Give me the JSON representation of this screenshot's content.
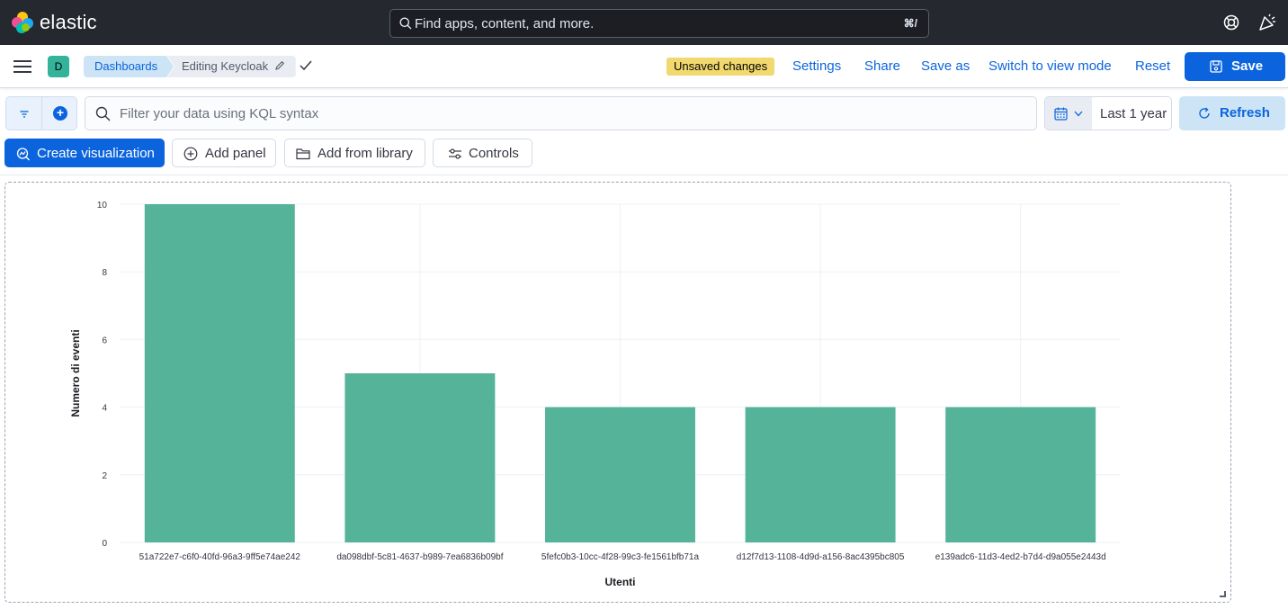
{
  "header": {
    "logo_text": "elastic",
    "search_placeholder": "Find apps, content, and more.",
    "search_shortcut": "⌘/"
  },
  "breadcrumbs": {
    "space_initial": "D",
    "items": [
      "Dashboards",
      "Editing Keycloak"
    ]
  },
  "top_actions": {
    "unsaved_badge": "Unsaved changes",
    "settings": "Settings",
    "share": "Share",
    "save_as": "Save as",
    "switch_mode": "Switch to view mode",
    "reset": "Reset",
    "save": "Save"
  },
  "query_bar": {
    "placeholder": "Filter your data using KQL syntax",
    "date_range": "Last 1 year",
    "refresh": "Refresh"
  },
  "toolbar": {
    "create_visualization": "Create visualization",
    "add_panel": "Add panel",
    "add_from_library": "Add from library",
    "controls": "Controls"
  },
  "colors": {
    "accent": "#0b64dd",
    "bar": "#54b399",
    "header_bg": "#25282f"
  },
  "chart_data": {
    "type": "bar",
    "categories": [
      "51a722e7-c6f0-40fd-96a3-9ff5e74ae242",
      "da098dbf-5c81-4637-b989-7ea6836b09bf",
      "5fefc0b3-10cc-4f28-99c3-fe1561bfb71a",
      "d12f7d13-1108-4d9d-a156-8ac4395bc805",
      "e139adc6-11d3-4ed2-b7d4-d9a055e2443d"
    ],
    "values": [
      10,
      5,
      4,
      4,
      4
    ],
    "title": "",
    "xlabel": "Utenti",
    "ylabel": "Numero di eventi",
    "ylim": [
      0,
      10
    ],
    "yticks": [
      0,
      2,
      4,
      6,
      8,
      10
    ],
    "grid": true
  }
}
